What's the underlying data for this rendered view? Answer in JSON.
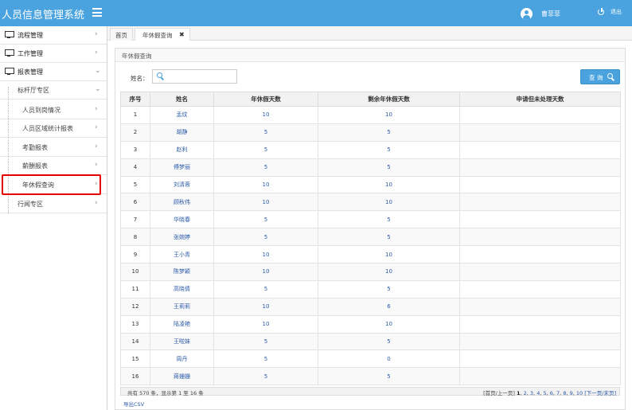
{
  "header": {
    "app_title": "人员信息管理系统",
    "user_name": "曹菲菲",
    "logout_label": "退出",
    "accent_color": "#4aa3df"
  },
  "sidebar": {
    "items": [
      {
        "label": "流程管理",
        "icon": "monitor-icon"
      },
      {
        "label": "工作管理",
        "icon": "monitor-icon"
      },
      {
        "label": "报表管理",
        "icon": "monitor-icon"
      },
      {
        "label": "标杆厅专区"
      },
      {
        "label": "人员到岗情况"
      },
      {
        "label": "人员区域统计报表"
      },
      {
        "label": "考勤报表"
      },
      {
        "label": "薪酬报表"
      },
      {
        "label": "年休假查询"
      },
      {
        "label": "行闻专区"
      }
    ]
  },
  "tabs": [
    {
      "label": "首页"
    },
    {
      "label": "年休假查询",
      "close": "✖"
    }
  ],
  "panel": {
    "title": "年休假查询",
    "search_label": "姓名：",
    "search_value": "",
    "query_button": "查 询"
  },
  "table": {
    "headers": [
      "序号",
      "姓名",
      "年休假天数",
      "剩余年休假天数",
      "申请但未处理天数"
    ],
    "rows": [
      [
        "1",
        "孟纹",
        "10",
        "10",
        ""
      ],
      [
        "2",
        "胡静",
        "5",
        "5",
        ""
      ],
      [
        "3",
        "赵利",
        "5",
        "5",
        ""
      ],
      [
        "4",
        "傅梦丽",
        "5",
        "5",
        ""
      ],
      [
        "5",
        "刘清蓉",
        "10",
        "10",
        ""
      ],
      [
        "6",
        "顾秋伟",
        "10",
        "10",
        ""
      ],
      [
        "7",
        "华晓春",
        "5",
        "5",
        ""
      ],
      [
        "8",
        "张婉婷",
        "5",
        "5",
        ""
      ],
      [
        "9",
        "王小青",
        "10",
        "10",
        ""
      ],
      [
        "10",
        "陈梦颖",
        "10",
        "10",
        ""
      ],
      [
        "11",
        "高晓倩",
        "5",
        "5",
        ""
      ],
      [
        "12",
        "王莉莉",
        "10",
        "6",
        ""
      ],
      [
        "13",
        "陆凌艳",
        "10",
        "10",
        ""
      ],
      [
        "14",
        "王啦妹",
        "5",
        "5",
        ""
      ],
      [
        "15",
        "周丹",
        "5",
        "0",
        ""
      ],
      [
        "16",
        "蒋姗姗",
        "5",
        "5",
        ""
      ]
    ]
  },
  "footer": {
    "count_text": "共有 570 条，显示第 1 至 16 条",
    "pager_prefix": "[首页/上一页]",
    "current_page": "1",
    "pages": [
      "2",
      "3",
      "4",
      "5",
      "6",
      "7",
      "8",
      "9",
      "10"
    ],
    "pager_suffix": "[下一页/末页]",
    "export_label": "导出CSV"
  }
}
